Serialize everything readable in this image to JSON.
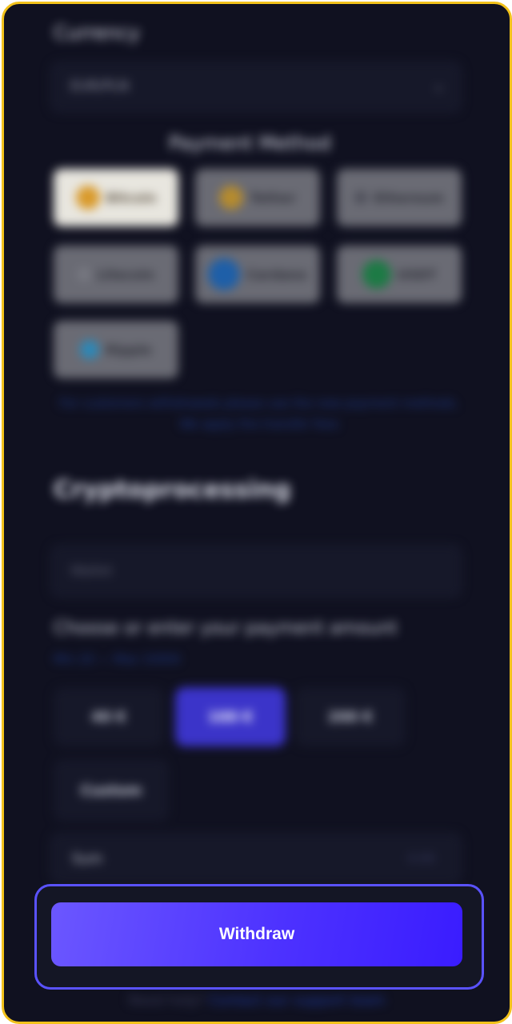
{
  "currency": {
    "label": "Currency",
    "value": "EUR/PLN"
  },
  "payment": {
    "title": "Payment Method",
    "methods": [
      {
        "name": "Bitcoin",
        "color": "#d99a2b",
        "selected": true
      },
      {
        "name": "Tether",
        "color": "#b58b2e",
        "selected": false
      },
      {
        "name": "Ethereum",
        "color": "#4b4c57",
        "selected": false
      },
      {
        "name": "Litecoin",
        "color": "#7a7b84",
        "selected": false
      },
      {
        "name": "Cardano",
        "color": "#1e5fa8",
        "selected": false
      },
      {
        "name": "USDT",
        "color": "#1d7a45",
        "selected": false
      },
      {
        "name": "Ripple",
        "color": "#2c88b8",
        "selected": false
      }
    ],
    "notice": "For customers withdrawals please use the new payment methods. We apply the transfer fees"
  },
  "processing": {
    "title": "Cryptoprocessing",
    "wallet_placeholder": "Wallet"
  },
  "amount": {
    "prompt": "Choose or enter your payment amount",
    "limits": "Min 20 — Max 10000",
    "options": [
      {
        "label": "40 €",
        "selected": false
      },
      {
        "label": "100 €",
        "selected": true
      },
      {
        "label": "200 €",
        "selected": false
      }
    ],
    "custom_label": "Custom",
    "sum_label": "Sum",
    "sum_value": "0.00"
  },
  "actions": {
    "withdraw_label": "Withdraw"
  },
  "footer": {
    "text": "Need help?",
    "link": "Contact our support team"
  },
  "colors": {
    "frame_border": "#f2c21b",
    "accent": "#5a52ff",
    "background": "#101120"
  }
}
